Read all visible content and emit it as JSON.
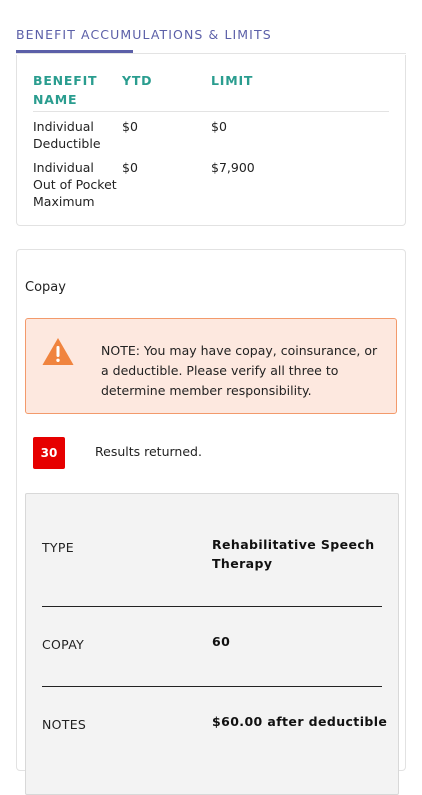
{
  "section": {
    "tab_label": "BENEFIT ACCUMULATIONS & LIMITS"
  },
  "accumulations": {
    "headers": {
      "name": "BENEFIT NAME",
      "ytd": "YTD",
      "limit": "LIMIT"
    },
    "rows": [
      {
        "name": "Individual Deductible",
        "ytd": "$0",
        "limit": "$0"
      },
      {
        "name": "Individual Out of Pocket Maximum",
        "ytd": "$0",
        "limit": "$7,900"
      }
    ]
  },
  "copay": {
    "title": "Copay",
    "note": "NOTE: You may have copay, coinsurance, or a deductible. Please verify all three to determine member responsibility.",
    "results_count": "30",
    "results_text": "Results returned.",
    "detail": {
      "type_label": "TYPE",
      "type_value": "Rehabilitative Speech Therapy",
      "copay_label": "COPAY",
      "copay_value": "60",
      "notes_label": "NOTES",
      "notes_value": "$60.00 after deductible"
    }
  },
  "colors": {
    "tab_accent": "#5b5fa8",
    "header_teal": "#2a9d8f",
    "warning_orange": "#f39a6b",
    "warning_bg": "#fde8df",
    "badge_red": "#e60000"
  },
  "icons": {
    "note_icon": "warning-triangle-icon"
  }
}
